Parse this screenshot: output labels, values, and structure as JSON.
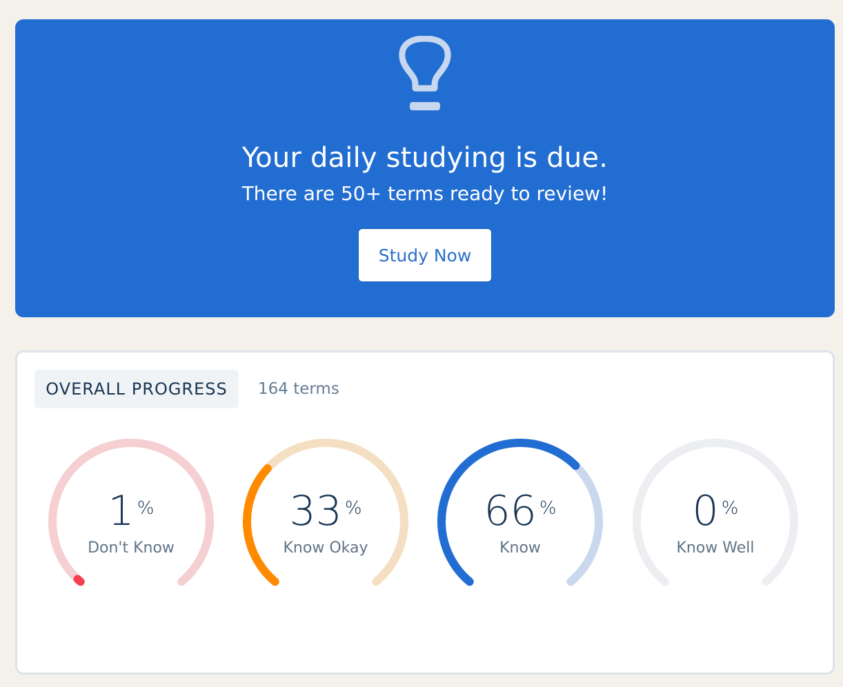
{
  "banner": {
    "icon": "lightbulb-icon",
    "title": "Your daily studying is due.",
    "subtitle": "There are 50+ terms ready to review!",
    "button_label": "Study Now",
    "background_color": "#226dd1"
  },
  "progress": {
    "tag": "OVERALL PROGRESS",
    "term_count": "164 terms",
    "gauges": [
      {
        "value": "1",
        "percent_sign": "%",
        "label": "Don't Know",
        "fraction": 0.01,
        "color": "#f43f4d",
        "track_color": "#f5cfd1"
      },
      {
        "value": "33",
        "percent_sign": "%",
        "label": "Know Okay",
        "fraction": 0.33,
        "color": "#ff8a00",
        "track_color": "#f5dfc2"
      },
      {
        "value": "66",
        "percent_sign": "%",
        "label": "Know",
        "fraction": 0.66,
        "color": "#226dd1",
        "track_color": "#c9d8ec"
      },
      {
        "value": "0",
        "percent_sign": "%",
        "label": "Know Well",
        "fraction": 0.0,
        "color": "#c4c9cf",
        "track_color": "#eceef1"
      }
    ]
  }
}
